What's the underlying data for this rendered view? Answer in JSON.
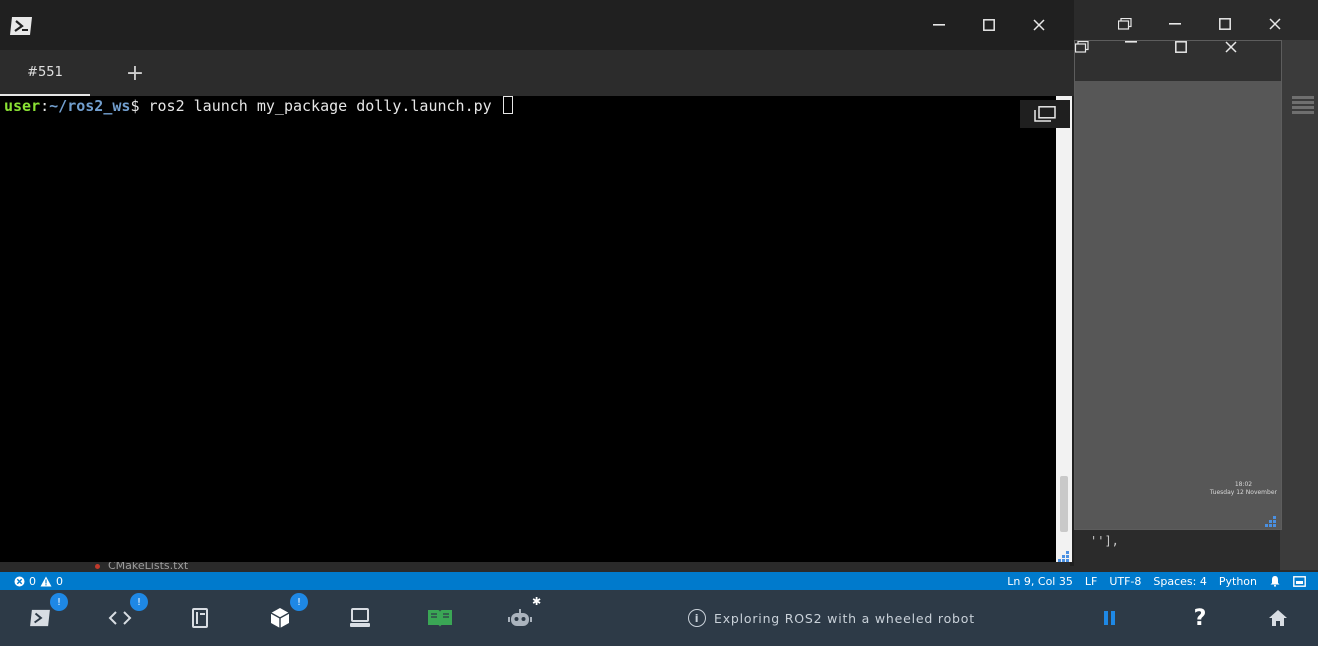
{
  "terminal": {
    "tab_label": "#551",
    "add_tab": "+",
    "prompt_user": "user",
    "prompt_sep": ":",
    "prompt_path": "~/ros2_ws",
    "prompt_symbol": "$",
    "command": " ros2 launch my_package dolly.launch.py "
  },
  "background_ide": {
    "code_fragment": "''],",
    "peek_file": "CMakeLists.txt"
  },
  "middle_window": {
    "clock_time": "18:02",
    "clock_date": "Tuesday 12 November"
  },
  "status_bar": {
    "errors": "0",
    "warnings": "0",
    "cursor_pos": "Ln 9, Col 35",
    "line_ending": "LF",
    "encoding": "UTF-8",
    "indent": "Spaces: 4",
    "language": "Python"
  },
  "dock": {
    "badge_terminal": "!",
    "badge_code": "!",
    "badge_ros": "!",
    "robot_star": "✱",
    "title": "Exploring ROS2 with a wheeled robot",
    "help": "?"
  },
  "colors": {
    "accent": "#007acc",
    "dock_bg": "#2d3a47",
    "badge": "#1e88e5",
    "prompt_user": "#8ae234",
    "prompt_path": "#729fcf"
  }
}
